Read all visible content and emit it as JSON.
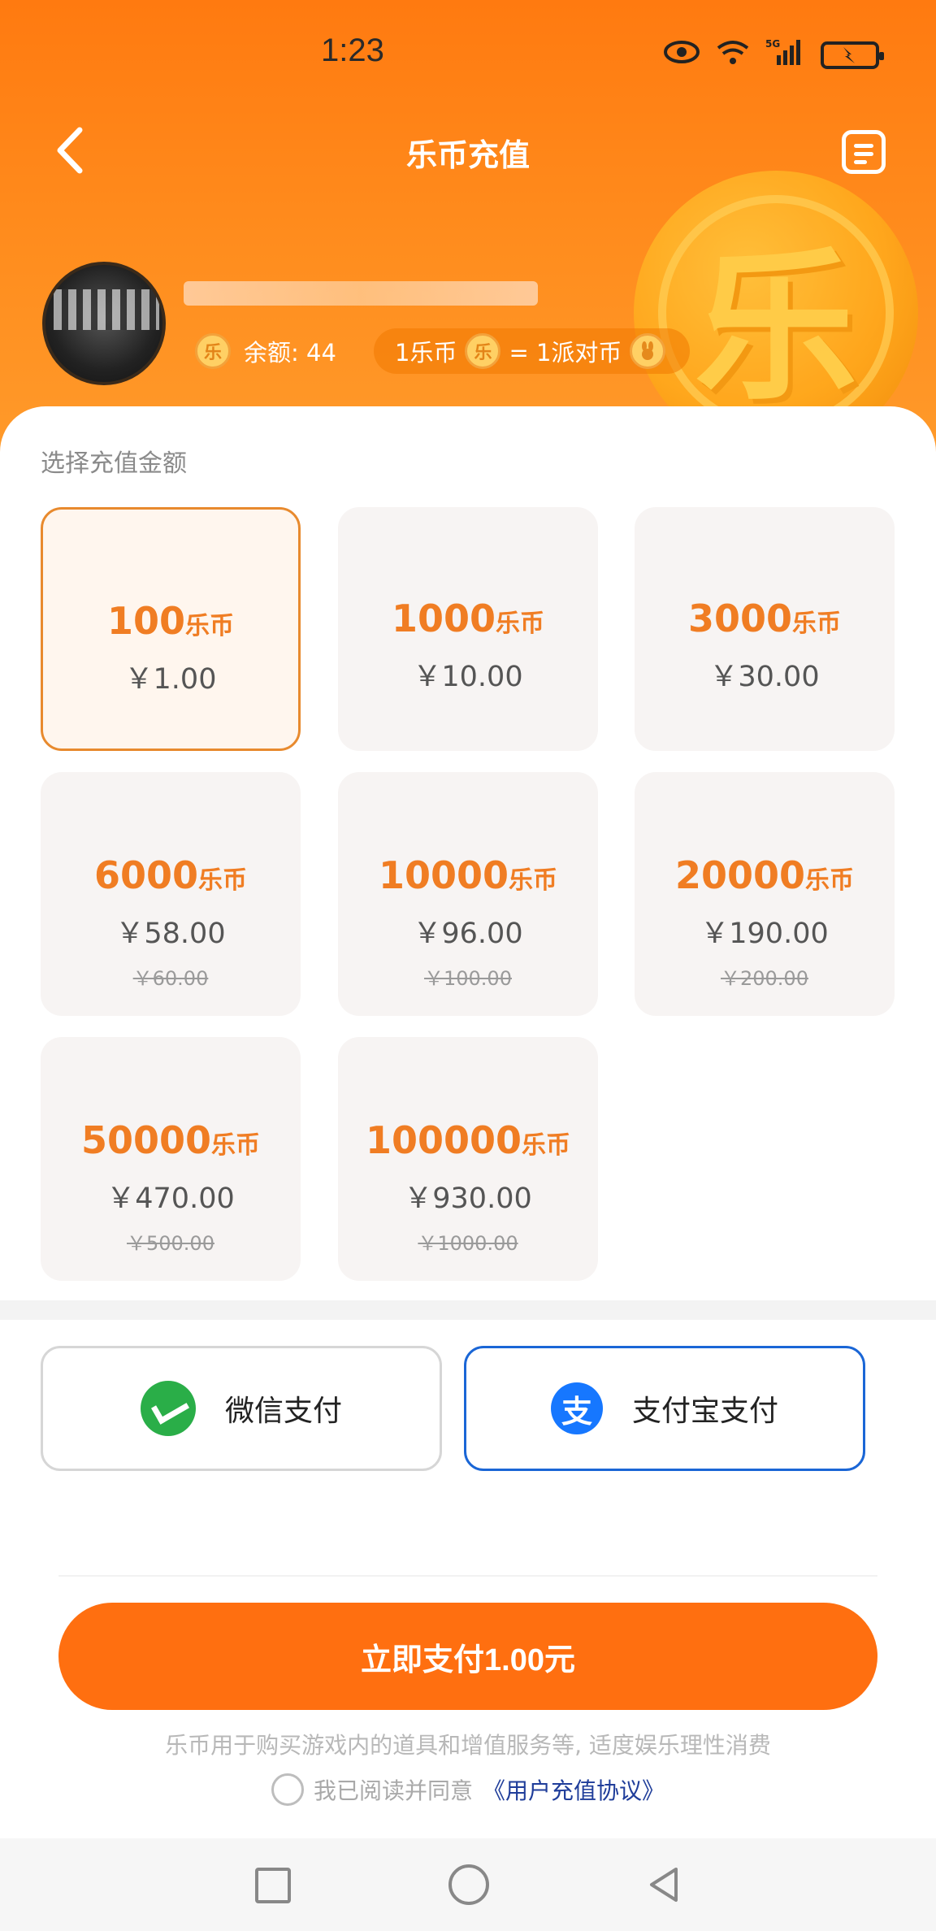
{
  "status": {
    "time": "1:23",
    "network": "5G"
  },
  "header": {
    "title": "乐币充值"
  },
  "user": {
    "balance_label": "余额: 44",
    "coin_glyph": "乐",
    "rate_left": "1乐币",
    "rate_right": "= 1派对币"
  },
  "recharge": {
    "section_label": "选择充值金额",
    "unit": "乐币",
    "options": [
      {
        "coins": "100",
        "price": "￥1.00",
        "original": "",
        "selected": true
      },
      {
        "coins": "1000",
        "price": "￥10.00",
        "original": ""
      },
      {
        "coins": "3000",
        "price": "￥30.00",
        "original": ""
      },
      {
        "coins": "6000",
        "price": "￥58.00",
        "original": "￥60.00"
      },
      {
        "coins": "10000",
        "price": "￥96.00",
        "original": "￥100.00"
      },
      {
        "coins": "20000",
        "price": "￥190.00",
        "original": "￥200.00"
      },
      {
        "coins": "50000",
        "price": "￥470.00",
        "original": "￥500.00"
      },
      {
        "coins": "100000",
        "price": "￥930.00",
        "original": "￥1000.00"
      }
    ]
  },
  "payment": {
    "wechat_label": "微信支付",
    "alipay_label": "支付宝支付",
    "alipay_glyph": "支",
    "selected": "alipay"
  },
  "submit": {
    "label": "立即支付1.00元"
  },
  "footer": {
    "note": "乐币用于购买游戏内的道具和增值服务等, 适度娱乐理性消费",
    "agree_text": "我已阅读并同意",
    "agreement_link": "《用户充值协议》"
  },
  "colors": {
    "accent": "#ff6f10",
    "coin_text": "#f07d23",
    "alipay": "#1677ff",
    "wechat": "#2aae48"
  }
}
